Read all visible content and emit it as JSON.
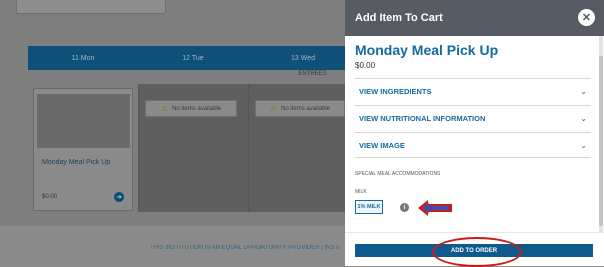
{
  "background": {
    "days": [
      "11 Mon",
      "12 Tue",
      "13 Wed"
    ],
    "section_label": "ENTREES",
    "no_items_label": "No items available",
    "meal_card": {
      "title": "Monday Meal Pick Up",
      "price": "$0.00"
    },
    "footer_text": "THIS INSTITUTION IS AN EQUAL OPPORTUNITY PROVIDER  |  INSTI"
  },
  "modal": {
    "title": "Add Item To Cart",
    "item_name": "Monday Meal Pick Up",
    "item_price": "$0.00",
    "accordions": [
      {
        "label": "VIEW INGREDIENTS"
      },
      {
        "label": "VIEW NUTRITIONAL INFORMATION"
      },
      {
        "label": "VIEW IMAGE"
      }
    ],
    "special_accommodations_label": "SPECIAL MEAL ACCOMMODATIONS",
    "milk_label": "MILK",
    "milk_option": "1% MILK",
    "add_button": "ADD TO ORDER"
  },
  "colors": {
    "accent": "#136b9e",
    "header": "#575b63",
    "annotation": "#cc1b1b"
  },
  "icons": {
    "close": "close-icon",
    "chevron": "chevron-down-icon",
    "info": "info-icon",
    "warning": "warning-icon",
    "arrow": "arrow-right-icon"
  }
}
